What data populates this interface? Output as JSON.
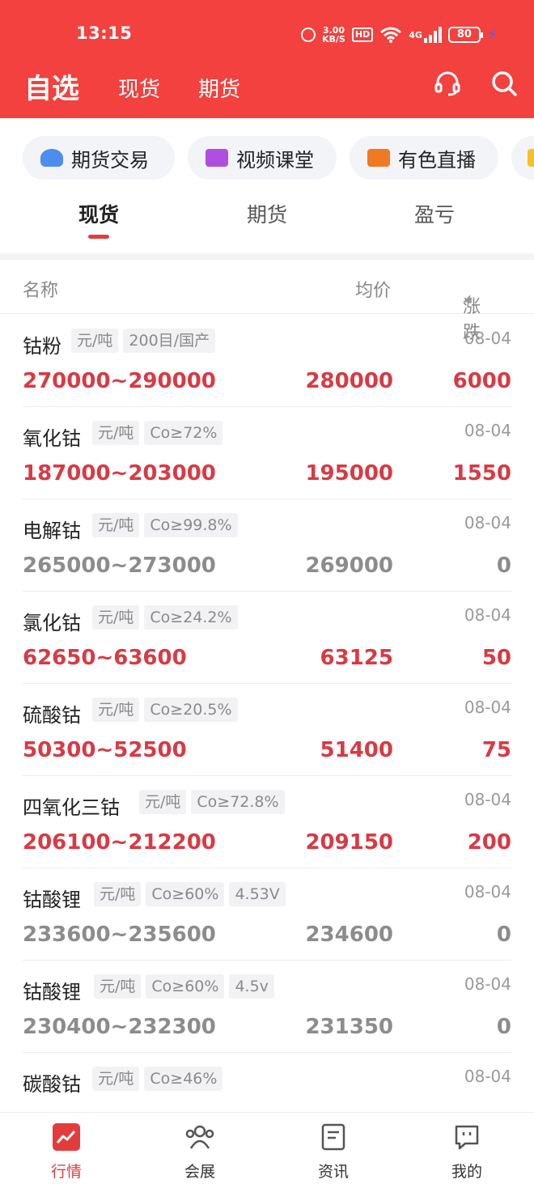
{
  "status_bar": {
    "time": "13:15",
    "net_speed_value": "3.00",
    "net_speed_unit": "KB/S",
    "hd_label": "HD",
    "network_label": "4G",
    "battery": "80"
  },
  "header": {
    "title": "自选",
    "tab_spot": "现货",
    "tab_futures": "期货"
  },
  "shortcuts": [
    {
      "label": "期货交易",
      "icon": "user-trade-icon",
      "color": "#4d8df0"
    },
    {
      "label": "视频课堂",
      "icon": "video-class-icon",
      "color": "#b04ee0"
    },
    {
      "label": "有色直播",
      "icon": "live-camera-icon",
      "color": "#f07a24"
    }
  ],
  "tabs": [
    {
      "label": "现货"
    },
    {
      "label": "期货"
    },
    {
      "label": "盈亏"
    }
  ],
  "table_header": {
    "name": "名称",
    "avg": "均价",
    "change": "涨跌"
  },
  "rows": [
    {
      "name": "钴粉",
      "tags": [
        "元/吨",
        "200目/国产"
      ],
      "date": "08-04",
      "range": "270000~290000",
      "avg": "280000",
      "change": "6000",
      "trend": "up"
    },
    {
      "name": "氧化钴",
      "tags": [
        "元/吨",
        "Co≥72%"
      ],
      "date": "08-04",
      "range": "187000~203000",
      "avg": "195000",
      "change": "1550",
      "trend": "up"
    },
    {
      "name": "电解钴",
      "tags": [
        "元/吨",
        "Co≥99.8%"
      ],
      "date": "08-04",
      "range": "265000~273000",
      "avg": "269000",
      "change": "0",
      "trend": "flat"
    },
    {
      "name": "氯化钴",
      "tags": [
        "元/吨",
        "Co≥24.2%"
      ],
      "date": "08-04",
      "range": "62650~63600",
      "avg": "63125",
      "change": "50",
      "trend": "up"
    },
    {
      "name": "硫酸钴",
      "tags": [
        "元/吨",
        "Co≥20.5%"
      ],
      "date": "08-04",
      "range": "50300~52500",
      "avg": "51400",
      "change": "75",
      "trend": "up"
    },
    {
      "name": "四氧化三钴",
      "tags": [
        "元/吨",
        "Co≥72.8%"
      ],
      "date": "08-04",
      "range": "206100~212200",
      "avg": "209150",
      "change": "200",
      "trend": "up"
    },
    {
      "name": "钴酸锂",
      "tags": [
        "元/吨",
        "Co≥60%",
        "4.53V"
      ],
      "date": "08-04",
      "range": "233600~235600",
      "avg": "234600",
      "change": "0",
      "trend": "flat"
    },
    {
      "name": "钴酸锂",
      "tags": [
        "元/吨",
        "Co≥60%",
        "4.5v"
      ],
      "date": "08-04",
      "range": "230400~232300",
      "avg": "231350",
      "change": "0",
      "trend": "flat"
    },
    {
      "name": "碳酸钴",
      "tags": [
        "元/吨",
        "Co≥46%"
      ],
      "date": "08-04"
    }
  ],
  "bottom_nav": [
    {
      "label": "行情",
      "icon": "market-chart-icon"
    },
    {
      "label": "会展",
      "icon": "exhibition-people-icon"
    },
    {
      "label": "资讯",
      "icon": "news-document-icon"
    },
    {
      "label": "我的",
      "icon": "profile-chat-icon"
    }
  ],
  "colors": {
    "brand": "#f2413e",
    "up": "#d83a44",
    "flat": "#8c8c8c"
  }
}
